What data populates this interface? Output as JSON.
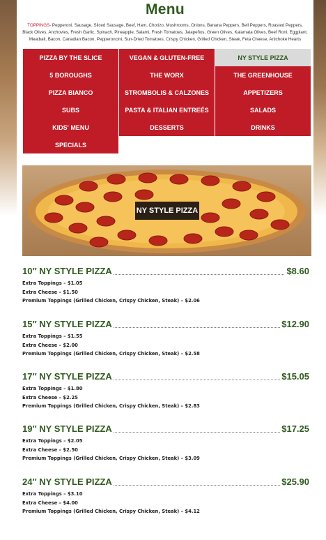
{
  "page_title": "Menu",
  "toppings": {
    "label": "TOPPINGS",
    "text": "- Pepperoni, Sausage, Sliced Sausage, Beef, Ham, Chorizo, Mushrooms, Onions, Banana Peppers, Bell Peppers, Roasted Peppers, Black Olives, Anchovies, Fresh Garlic, Spinach, Pineapple, Salami, Fresh Tomatoes, Jalapeños, Green Olives, Kalamata Olives, Beef Roni, Eggplant, Meatball, Bacon, Canadian Bacon, Pepperoncini, Sun-Dried Tomatoes, Crispy Chicken, Grilled Chicken, Steak, Feta Cheese, Artichoke Hearts"
  },
  "categories": [
    {
      "label": "PIZZA BY THE SLICE",
      "active": false
    },
    {
      "label": "VEGAN & GLUTEN-FREE",
      "active": false
    },
    {
      "label": "NY STYLE PIZZA",
      "active": true
    },
    {
      "label": "5 BOROUGHS",
      "active": false
    },
    {
      "label": "THE WORX",
      "active": false
    },
    {
      "label": "THE GREENHOUSE",
      "active": false
    },
    {
      "label": "PIZZA BIANCO",
      "active": false
    },
    {
      "label": "STROMBOLIS & CALZONES",
      "active": false
    },
    {
      "label": "APPETIZERS",
      "active": false
    },
    {
      "label": "SUBS",
      "active": false
    },
    {
      "label": "PASTA & ITALIAN ENTREÉS",
      "active": false
    },
    {
      "label": "SALADS",
      "active": false
    },
    {
      "label": "KIDS' MENU",
      "active": false
    },
    {
      "label": "DESSERTS",
      "active": false
    },
    {
      "label": "DRINKS",
      "active": false
    },
    {
      "label": "SPECIALS",
      "active": false
    }
  ],
  "hero_label": "NY STYLE PIZZA",
  "items": [
    {
      "name": "10″ NY STYLE PIZZA",
      "price": "$8.60",
      "lines": [
        "Extra Toppings – $1.05",
        "Extra Cheese – $1.50",
        "Premium Toppings (Grilled Chicken, Crispy Chicken, Steak) – $2.06"
      ]
    },
    {
      "name": "15″ NY STYLE PIZZA",
      "price": "$12.90",
      "lines": [
        "Extra Toppings – $1.55",
        "Extra Cheese – $2.00",
        "Premium Toppings (Grilled Chicken, Crispy Chicken, Steak) – $2.58"
      ]
    },
    {
      "name": "17″ NY STYLE PIZZA",
      "price": "$15.05",
      "lines": [
        "Extra Toppings – $1.80",
        "Extra Cheese – $2.25",
        "Premium Toppings (Grilled Chicken, Crispy Chicken, Steak) – $2.83"
      ]
    },
    {
      "name": "19″ NY STYLE PIZZA",
      "price": "$17.25",
      "lines": [
        "Extra Toppings – $2.05",
        "Extra Cheese – $2.50",
        "Premium Toppings (Grilled Chicken, Crispy Chicken, Steak) – $3.09"
      ]
    },
    {
      "name": "24″ NY STYLE PIZZA",
      "price": "$25.90",
      "lines": [
        "Extra Toppings – $3.10",
        "Extra Cheese – $4.00",
        "Premium Toppings (Grilled Chicken, Crispy Chicken, Steak) – $4.12"
      ]
    }
  ],
  "colors": {
    "accent_red": "#c01c28",
    "heading_green": "#2f5a1e",
    "active_tab_bg": "#dadada"
  }
}
